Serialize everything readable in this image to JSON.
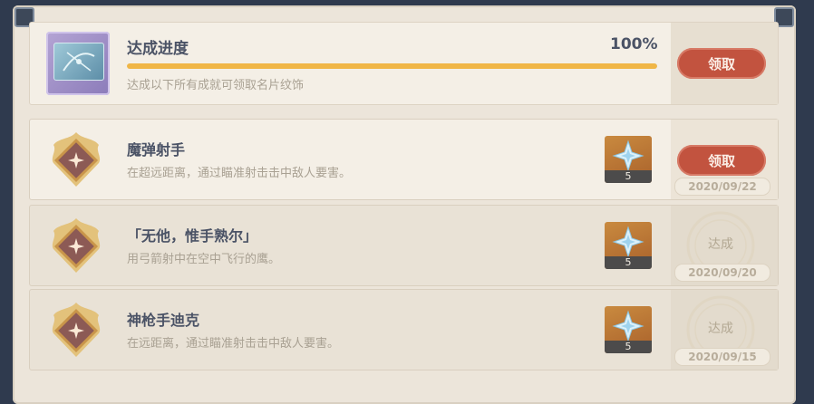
{
  "progress": {
    "title": "达成进度",
    "percent_text": "100%",
    "fraction": 1.0,
    "description": "达成以下所有成就可领取名片纹饰",
    "claim_label": "领取"
  },
  "achievements": [
    {
      "title": "魔弹射手",
      "description": "在超远距离，通过瞄准射击击中敌人要害。",
      "reward_count": "5",
      "status": "claim",
      "claim_label": "领取",
      "date": "2020/09/22"
    },
    {
      "title": "「无他，惟手熟尔」",
      "description": "用弓箭射中在空中飞行的鹰。",
      "reward_count": "5",
      "status": "done",
      "done_label": "达成",
      "date": "2020/09/20"
    },
    {
      "title": "神枪手迪克",
      "description": "在远距离，通过瞄准射击击中敌人要害。",
      "reward_count": "5",
      "status": "done",
      "done_label": "达成",
      "date": "2020/09/15"
    }
  ],
  "icons": {
    "namecard": "namecard-icon",
    "badge": "achievement-badge-icon",
    "reward": "primogem-icon",
    "stamp": "completed-stamp-icon"
  },
  "colors": {
    "accent_button": "#c2533f",
    "progress_fill": "#f0b646",
    "title_text": "#4b5366",
    "muted_text": "#a9a193"
  }
}
